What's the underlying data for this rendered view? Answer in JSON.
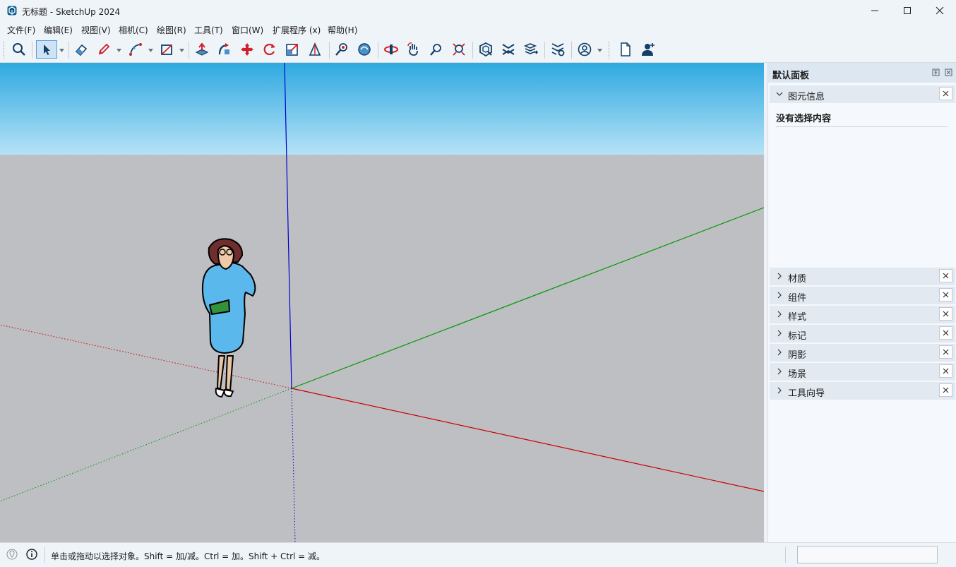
{
  "window": {
    "title": "无标题 - SketchUp 2024"
  },
  "menu": [
    "文件(F)",
    "编辑(E)",
    "视图(V)",
    "相机(C)",
    "绘图(R)",
    "工具(T)",
    "窗口(W)",
    "扩展程序 (x)",
    "帮助(H)"
  ],
  "toolbar": {
    "tools": [
      "search-icon",
      "select-arrow-icon",
      "eraser-icon",
      "pencil-icon",
      "arc-icon",
      "rectangle-icon",
      "push-pull-icon",
      "follow-me-icon",
      "move-icon",
      "rotate-icon",
      "scale-icon",
      "tape-measure-icon",
      "orbit-icon",
      "pan-icon",
      "walk-icon",
      "position-camera-icon",
      "zoom-icon",
      "zoom-extents-icon",
      "warehouse-icon",
      "extension-warehouse-icon",
      "layout-icon",
      "extension-manager-icon",
      "profile-icon",
      "new-file-icon",
      "add-user-icon"
    ]
  },
  "panel": {
    "title": "默认面板",
    "entity_info": {
      "label": "图元信息",
      "empty_text": "没有选择内容"
    },
    "trays": [
      "材质",
      "组件",
      "样式",
      "标记",
      "阴影",
      "场景",
      "工具向导"
    ]
  },
  "status": {
    "message": "单击或拖动以选择对象。Shift = 加/减。Ctrl = 加。Shift + Ctrl = 减。"
  },
  "colors": {
    "sky_top": "#2ea9e0",
    "sky_bottom": "#b6e2f7",
    "ground": "#bebfc3",
    "red_axis": "#cc0000",
    "green_axis": "#009900",
    "blue_axis": "#0000cc",
    "figure_dress": "#5bb8ec"
  }
}
